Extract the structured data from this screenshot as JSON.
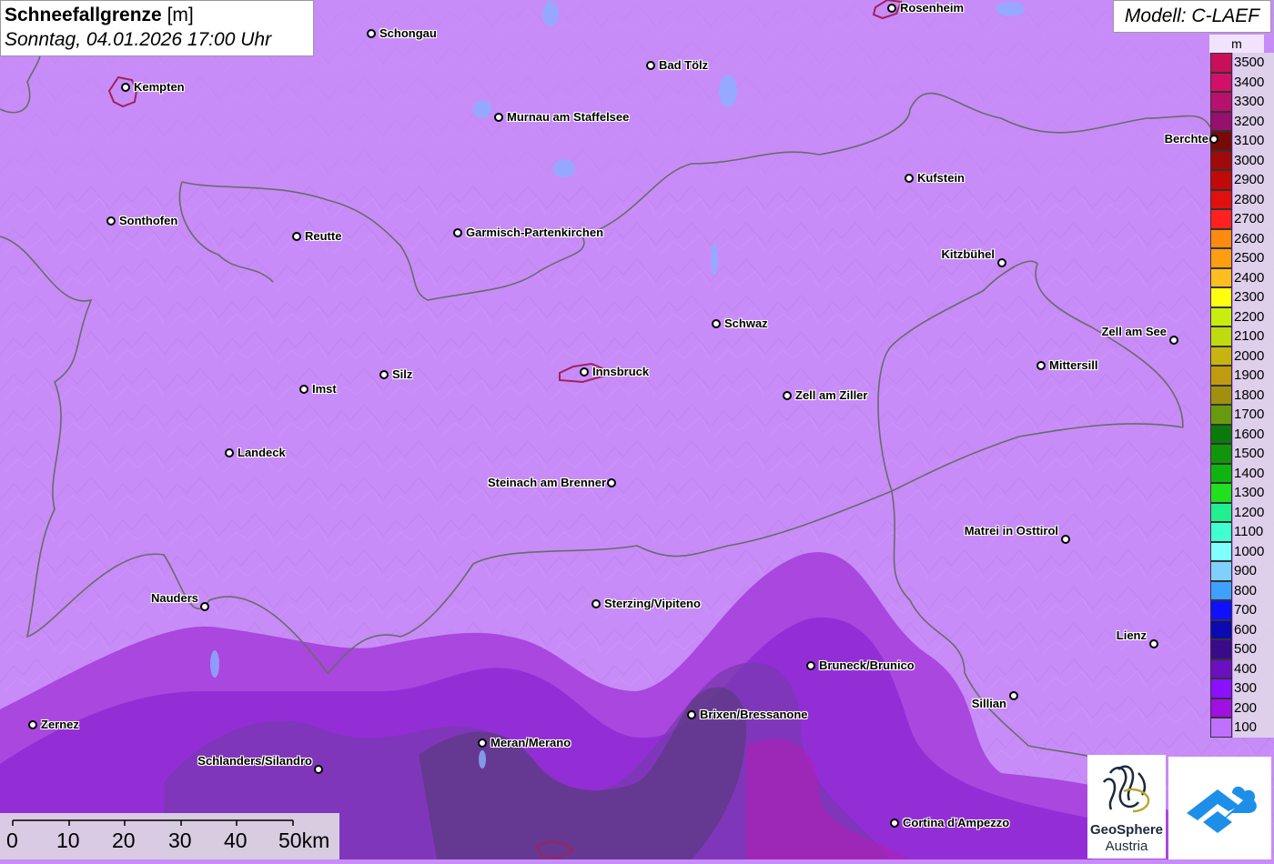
{
  "header": {
    "title": "Schneefallgrenze",
    "unit": "[m]",
    "subtitle": "Sonntag, 04.01.2026 17:00 Uhr",
    "model": "Modell: C-LAEF"
  },
  "legend": {
    "unit": "m",
    "entries": [
      {
        "label": "3500",
        "color": "#c8105a"
      },
      {
        "label": "3400",
        "color": "#d2106a"
      },
      {
        "label": "3300",
        "color": "#b8106e"
      },
      {
        "label": "3200",
        "color": "#96106e"
      },
      {
        "label": "3100",
        "color": "#7a0a0a"
      },
      {
        "label": "3000",
        "color": "#a00a0a"
      },
      {
        "label": "2900",
        "color": "#c00a0a"
      },
      {
        "label": "2800",
        "color": "#e01010"
      },
      {
        "label": "2700",
        "color": "#ff2020"
      },
      {
        "label": "2600",
        "color": "#ff8a10"
      },
      {
        "label": "2500",
        "color": "#ff9e10"
      },
      {
        "label": "2400",
        "color": "#ffbe20"
      },
      {
        "label": "2300",
        "color": "#ffff10"
      },
      {
        "label": "2200",
        "color": "#c8ee10"
      },
      {
        "label": "2100",
        "color": "#c0da10"
      },
      {
        "label": "2000",
        "color": "#c8b410"
      },
      {
        "label": "1900",
        "color": "#c09a10"
      },
      {
        "label": "1800",
        "color": "#a09010"
      },
      {
        "label": "1700",
        "color": "#689a10"
      },
      {
        "label": "1600",
        "color": "#0a7a0a"
      },
      {
        "label": "1500",
        "color": "#10960a"
      },
      {
        "label": "1400",
        "color": "#10b410"
      },
      {
        "label": "1300",
        "color": "#20e020"
      },
      {
        "label": "1200",
        "color": "#20f090"
      },
      {
        "label": "1100",
        "color": "#40ffd0"
      },
      {
        "label": "1000",
        "color": "#80ffff"
      },
      {
        "label": "900",
        "color": "#80d0ff"
      },
      {
        "label": "800",
        "color": "#40a0ff"
      },
      {
        "label": "700",
        "color": "#1010ff"
      },
      {
        "label": "600",
        "color": "#0a0ab0"
      },
      {
        "label": "500",
        "color": "#3a0a8a"
      },
      {
        "label": "400",
        "color": "#6a10c0"
      },
      {
        "label": "300",
        "color": "#8a10ff"
      },
      {
        "label": "200",
        "color": "#a010e0"
      },
      {
        "label": "100",
        "color": "#c070ff"
      }
    ]
  },
  "cities": [
    {
      "name": "Rosenheim",
      "side": "right"
    },
    {
      "name": "Schongau",
      "side": "right"
    },
    {
      "name": "Kempten",
      "side": "right"
    },
    {
      "name": "Bad Tölz",
      "side": "right"
    },
    {
      "name": "Murnau am Staffelsee",
      "side": "right"
    },
    {
      "name": "Berchte",
      "side": "left"
    },
    {
      "name": "Kufstein",
      "side": "right"
    },
    {
      "name": "Sonthofen",
      "side": "right"
    },
    {
      "name": "Reutte",
      "side": "right"
    },
    {
      "name": "Garmisch-Partenkirchen",
      "side": "right"
    },
    {
      "name": "Kitzbühel",
      "side": "left"
    },
    {
      "name": "Schwaz",
      "side": "right"
    },
    {
      "name": "Zell am See",
      "side": "left"
    },
    {
      "name": "Mittersill",
      "side": "right"
    },
    {
      "name": "Innsbruck",
      "side": "right"
    },
    {
      "name": "Silz",
      "side": "right"
    },
    {
      "name": "Imst",
      "side": "right"
    },
    {
      "name": "Zell am Ziller",
      "side": "right"
    },
    {
      "name": "Landeck",
      "side": "right"
    },
    {
      "name": "Steinach am Brenner",
      "side": "left"
    },
    {
      "name": "Matrei in Osttirol",
      "side": "left"
    },
    {
      "name": "Nauders",
      "side": "left"
    },
    {
      "name": "Sterzing/Vipiteno",
      "side": "right"
    },
    {
      "name": "Lienz",
      "side": "left"
    },
    {
      "name": "Bruneck/Brunico",
      "side": "right"
    },
    {
      "name": "Sillian",
      "side": "left"
    },
    {
      "name": "Brixen/Bressanone",
      "side": "right"
    },
    {
      "name": "Zernez",
      "side": "right"
    },
    {
      "name": "Meran/Merano",
      "side": "right"
    },
    {
      "name": "Schlanders/Silandro",
      "side": "left"
    },
    {
      "name": "Cortina d'Ampezzo",
      "side": "right"
    }
  ],
  "scale": {
    "ticks": [
      "0",
      "10",
      "20",
      "30",
      "40",
      "50km"
    ]
  },
  "logos": {
    "geosphere_line1": "GeoSphere",
    "geosphere_line2": "Austria"
  }
}
